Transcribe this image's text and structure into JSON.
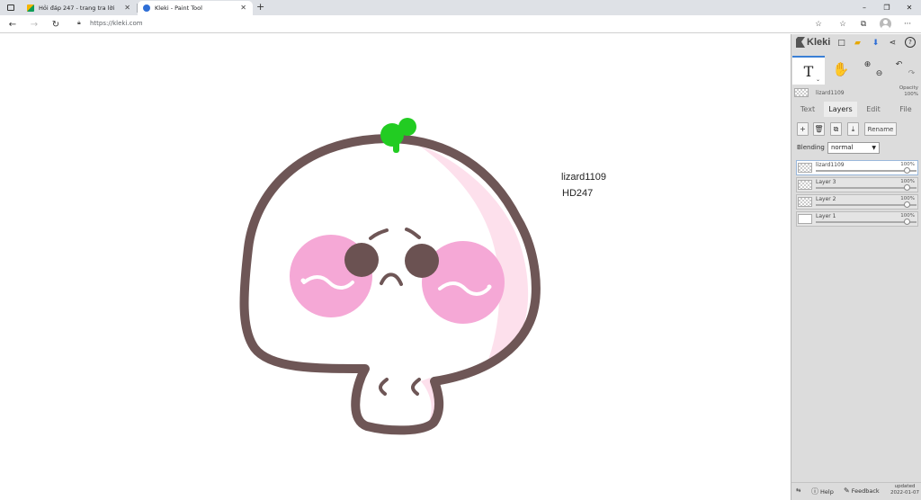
{
  "browser": {
    "tabs": [
      {
        "title": "Hỏi đáp 247 - trang tra lời",
        "active": false
      },
      {
        "title": "Kleki - Paint Tool",
        "active": true
      }
    ],
    "new_tab": "+",
    "window_controls": {
      "minimize": "–",
      "restore": "❐",
      "close": "✕"
    },
    "url": "https://kleki.com",
    "nav": {
      "back": "←",
      "forward": "→",
      "reload": "↻"
    },
    "toolbar_icons": {
      "favorite": "☆",
      "collections": "⧉",
      "more": "···"
    }
  },
  "canvas": {
    "texts": [
      "lizard1109",
      "HD247"
    ],
    "colors": {
      "outline": "#6e5656",
      "body": "#ffffff",
      "highlight": "#fde0ec",
      "blush": "#f5a8d6",
      "eyes": "#6b5252",
      "sprout": "#22cc22"
    }
  },
  "panel": {
    "app_name": "Kleki",
    "header_icons": [
      "new-image-icon",
      "save-icon",
      "download-icon",
      "share-icon",
      "help-icon"
    ],
    "tools": {
      "text": "T",
      "hand": "✋",
      "zoom_in": "⊕",
      "zoom_out": "⊖",
      "undo": "↶",
      "redo": "↷"
    },
    "brush": {
      "name": "lizard1109",
      "opacity_label": "Opacity",
      "opacity_value": "100%"
    },
    "tabs": [
      {
        "label": "Text",
        "active": false
      },
      {
        "label": "Layers",
        "active": true
      },
      {
        "label": "Edit",
        "active": false
      },
      {
        "label": "File",
        "active": false
      }
    ],
    "layer_buttons": {
      "add": "+",
      "delete": "🗑",
      "duplicate": "⧉",
      "merge": "⤓",
      "rename": "Rename"
    },
    "blending": {
      "label": "Blending",
      "value": "normal"
    },
    "layers": [
      {
        "name": "lizard1109",
        "opacity": "100%",
        "selected": true
      },
      {
        "name": "Layer 3",
        "opacity": "100%",
        "selected": false
      },
      {
        "name": "Layer 2",
        "opacity": "100%",
        "selected": false
      },
      {
        "name": "Layer 1",
        "opacity": "100%",
        "selected": false
      }
    ],
    "footer": {
      "swap": "⇆",
      "help": "Help",
      "feedback": "Feedback",
      "updated_label": "updated",
      "updated_date": "2022-01-07"
    }
  }
}
